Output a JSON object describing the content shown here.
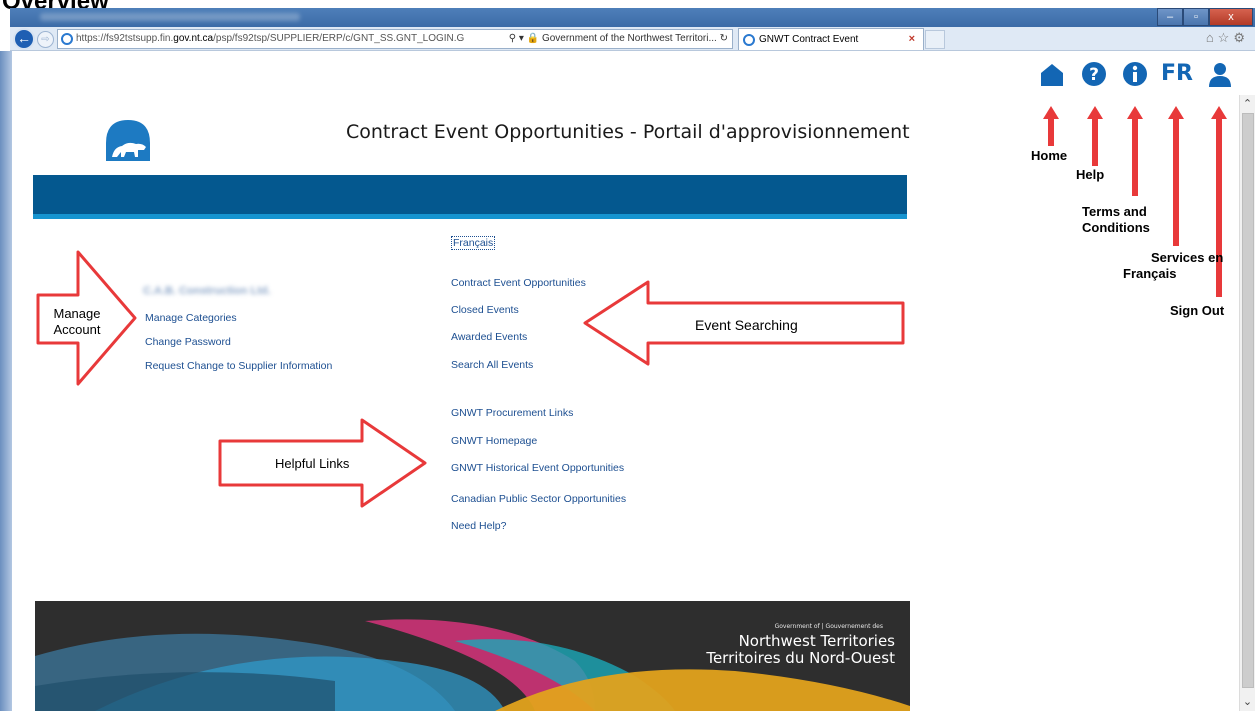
{
  "document": {
    "heading": "Overview"
  },
  "browser": {
    "url_prefix": "https://fs92tstsupp.fin.",
    "url_host": "gov.nt.ca",
    "url_path": "/psp/fs92tsp/SUPPLIER/ERP/c/GNT_SS.GNT_LOGIN.G",
    "url_site": "Government of the Northwest Territori...",
    "search_glyph": "⚲ ▾",
    "lock_glyph": "🔒",
    "refresh_glyph": "↻",
    "tab_title": "GNWT Contract Event",
    "tab_close": "×",
    "back_glyph": "←",
    "forward_glyph": "⇨",
    "toolbar_icons": "⌂☆⚙",
    "minimize": "–",
    "restore": "▫",
    "close": "x"
  },
  "page": {
    "title": "Contract Event Opportunities - Portail d'approvisionnement",
    "french_link": "Français",
    "company_name": "C.A.B. Construction Ltd.",
    "account_links": [
      "Manage Categories",
      "Change Password",
      "Request Change to Supplier Information"
    ],
    "event_links": [
      "Contract Event Opportunities",
      "Closed Events",
      "Awarded Events",
      "Search All Events"
    ],
    "helpful_links": [
      "GNWT Procurement Links",
      "GNWT Homepage",
      "GNWT Historical Event Opportunities",
      "Canadian Public Sector Opportunities",
      "Need Help?"
    ],
    "footer_gov": "Government of | Gouvernement des",
    "footer_line1": "Northwest Territories",
    "footer_line2": "Territoires du Nord-Ouest"
  },
  "top_nav": {
    "home_icon": "home-icon",
    "help_icon": "help-icon",
    "info_icon": "info-icon",
    "fr_label": "FR",
    "user_icon": "user-icon"
  },
  "annotations": {
    "home": "Home",
    "help": "Help",
    "terms_line1": "Terms and",
    "terms_line2": "Conditions",
    "services_line1": "Services en",
    "services_line2": "Français",
    "sign_out": "Sign Out",
    "manage_line1": "Manage",
    "manage_line2": "Account",
    "event_searching": "Event Searching",
    "helpful_links": "Helpful Links"
  },
  "colors": {
    "brand_blue": "#04588f",
    "accent_cyan": "#1694d0",
    "link": "#1d4f91",
    "icon_blue": "#1366b4",
    "arrow_red": "#e8393a"
  }
}
